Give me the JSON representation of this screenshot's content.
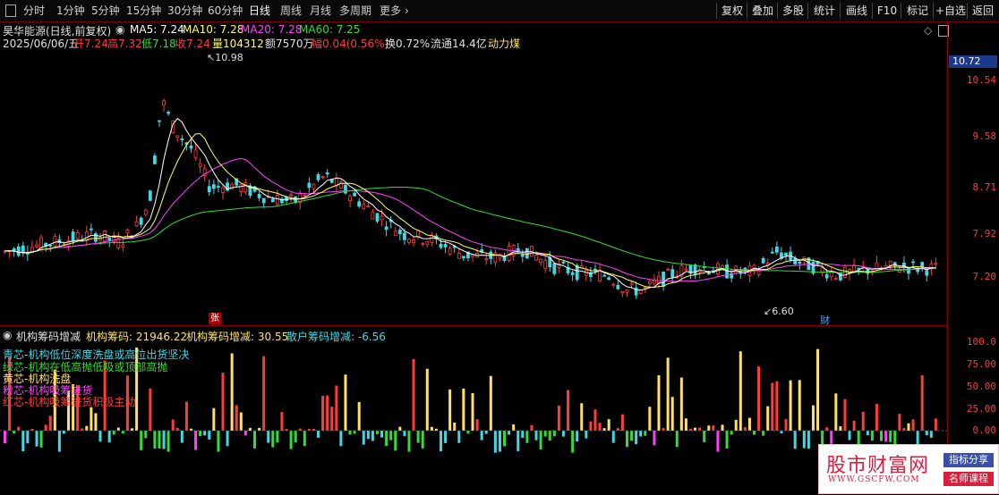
{
  "toolbar": {
    "periods": [
      "分时",
      "1分钟",
      "5分钟",
      "15分钟",
      "30分钟",
      "60分钟",
      "日线",
      "周线",
      "月线",
      "多周期",
      "更多"
    ],
    "active_period": "日线",
    "right_buttons": [
      "复权",
      "叠加",
      "多股",
      "统计",
      "画线",
      "F10",
      "标记",
      "+自选",
      "返回"
    ]
  },
  "stock": {
    "name": "昊华能源(日线,前复权)",
    "date": "2025/06/06/五",
    "open_label": "开7.24",
    "high_label": "高7.32",
    "low_label": "低7.18",
    "close_label": "收7.24",
    "volume_label": "量104312",
    "amount_label": "额7570万",
    "change_label": "幅0.04(0.56%)",
    "turnover_label": "换0.72%",
    "float_label": "流通14.4亿",
    "concept_label": "动力煤"
  },
  "ma": {
    "ma5": "MA5: 7.24",
    "ma10": "MA10: 7.28",
    "ma20": "MA20: 7.28",
    "ma60": "MA60: 7.25"
  },
  "colors": {
    "up": "#ff3b3b",
    "down": "#3fd9e6",
    "ma5": "#ffffff",
    "ma10": "#ffff66",
    "ma20": "#ff40ff",
    "ma60": "#33dd33",
    "axis": "#8b0000"
  },
  "price_axis": {
    "ticks": [
      "10.54",
      "9.58",
      "8.71",
      "7.92",
      "7.20"
    ],
    "current": "10.72"
  },
  "annotations": {
    "high_label": "10.98",
    "low_label": "6.60",
    "event_zhang": "张",
    "event_cai": "财"
  },
  "indicator": {
    "title": "机构筹码增减",
    "value1_label": "机构筹码: 21946.22",
    "value2_label": "机构筹码增减: 30.55",
    "value3_label": "散户筹码增减: -6.56",
    "ticks": [
      "100.0",
      "75.00",
      "50.00",
      "25.00",
      "0.00"
    ],
    "legend": [
      {
        "text": "青芯-机构低位深度洗盘或高位出货坚决",
        "color": "#3fd9e6"
      },
      {
        "text": "绿芯-机构在低高抛低吸或顶部高抛",
        "color": "#33dd33"
      },
      {
        "text": "黄芯-机构洗盘",
        "color": "#ffe066"
      },
      {
        "text": "粉芯-机构吸筹进货",
        "color": "#ff40ff"
      },
      {
        "text": "红芯-机构吸筹进货积极主动",
        "color": "#ff3b3b"
      }
    ]
  },
  "chart_data": [
    {
      "type": "candlestick",
      "title": "昊华能源(日线,前复权)",
      "ylim": [
        6.6,
        10.98
      ],
      "series": [
        {
          "name": "MA5",
          "values": [
            7.24
          ]
        },
        {
          "name": "MA10",
          "values": [
            7.28
          ]
        },
        {
          "name": "MA20",
          "values": [
            7.28
          ]
        },
        {
          "name": "MA60",
          "values": [
            7.25
          ]
        }
      ],
      "last_bar": {
        "date": "2025/06/06",
        "open": 7.24,
        "high": 7.32,
        "low": 7.18,
        "close": 7.24
      }
    },
    {
      "type": "bar",
      "title": "机构筹码增减",
      "ylim": [
        -10,
        100
      ],
      "series": [
        {
          "name": "机构筹码增减",
          "values": [
            30.55
          ]
        },
        {
          "name": "散户筹码增减",
          "values": [
            -6.56
          ]
        }
      ]
    }
  ],
  "watermark": {
    "main": "股市财富网",
    "url": "WWW.GSCFW.COM",
    "tag1": "指标分享",
    "tag2": "名师课程"
  }
}
